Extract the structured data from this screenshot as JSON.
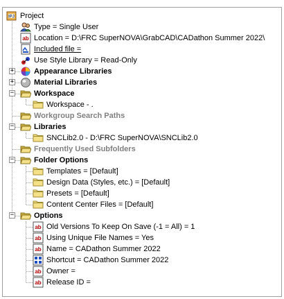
{
  "tree": {
    "root_label": "Project",
    "items": [
      {
        "label": "Type = Single User"
      },
      {
        "label": "Location = D:\\FRC SuperNOVA\\GrabCAD\\CADathon Summer 2022\\"
      },
      {
        "label": "Included file ="
      },
      {
        "label": "Use Style Library = Read-Only"
      },
      {
        "label": "Appearance Libraries"
      },
      {
        "label": "Material Libraries"
      },
      {
        "label": "Workspace"
      },
      {
        "label": "Workspace - ."
      },
      {
        "label": "Workgroup Search Paths"
      },
      {
        "label": "Libraries"
      },
      {
        "label": "SNCLib2.0 - D:\\FRC SuperNOVA\\SNCLib2.0"
      },
      {
        "label": "Frequently Used Subfolders"
      },
      {
        "label": "Folder Options"
      },
      {
        "label": "Templates = [Default]"
      },
      {
        "label": "Design Data (Styles, etc.) = [Default]"
      },
      {
        "label": "Presets = [Default]"
      },
      {
        "label": "Content Center Files = [Default]"
      },
      {
        "label": "Options"
      },
      {
        "label": "Old Versions To Keep On Save (-1 = All) = 1"
      },
      {
        "label": "Using Unique File Names = Yes"
      },
      {
        "label": "Name = CADathon Summer 2022"
      },
      {
        "label": "Shortcut = CADathon Summer 2022"
      },
      {
        "label": "Owner ="
      },
      {
        "label": "Release ID ="
      }
    ]
  },
  "colors": {
    "folder": "#f3e089",
    "folder_dark": "#c8ae3c",
    "gray_text": "#808080",
    "abc_red": "#b00000"
  }
}
